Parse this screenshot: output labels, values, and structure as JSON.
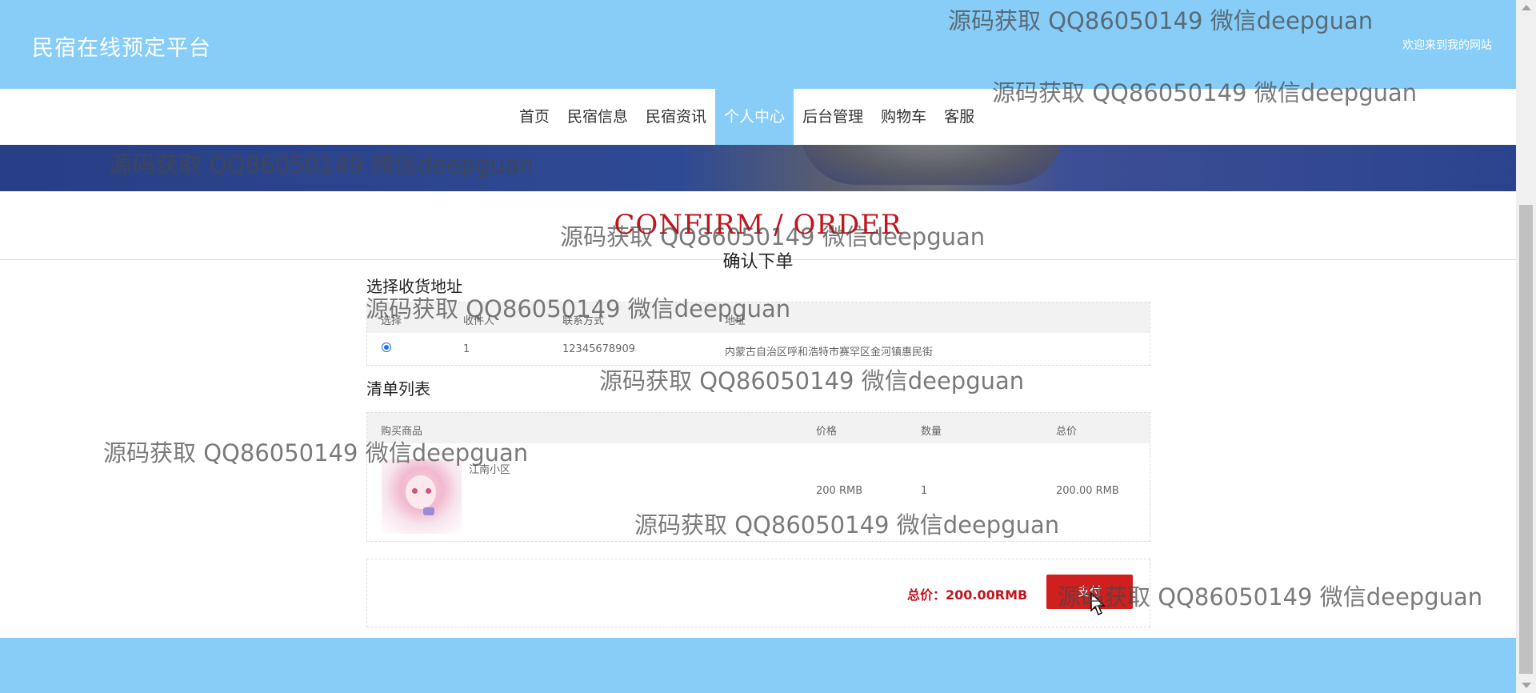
{
  "header": {
    "site_title": "民宿在线预定平台",
    "welcome": "欢迎来到我的网站"
  },
  "nav": {
    "items": [
      "首页",
      "民宿信息",
      "民宿资讯",
      "个人中心",
      "后台管理",
      "购物车",
      "客服"
    ],
    "active": "个人中心"
  },
  "section": {
    "title_en": "CONFIRM / ORDER",
    "title_cn": "确认下单"
  },
  "address": {
    "title": "选择收货地址",
    "columns": [
      "选择",
      "收件人",
      "联系方式",
      "地址"
    ],
    "rows": [
      {
        "selected": true,
        "recipient": "1",
        "phone": "12345678909",
        "address": "内蒙古自治区呼和浩特市赛罕区金河镇惠民街"
      }
    ]
  },
  "list": {
    "title": "清单列表",
    "columns": [
      "购买商品",
      "价格",
      "数量",
      "总价"
    ],
    "rows": [
      {
        "name": "江南小区",
        "price": "200 RMB",
        "quantity": "1",
        "total": "200.00 RMB"
      }
    ]
  },
  "summary": {
    "total_text": "总价：200.00RMB",
    "pay_label": "支付"
  },
  "watermark": {
    "text": "源码获取 QQ86050149 微信deepguan"
  },
  "colors": {
    "header_bg": "#87cdf7",
    "accent_red": "#c0151c",
    "pay_button": "#d11f1f"
  }
}
